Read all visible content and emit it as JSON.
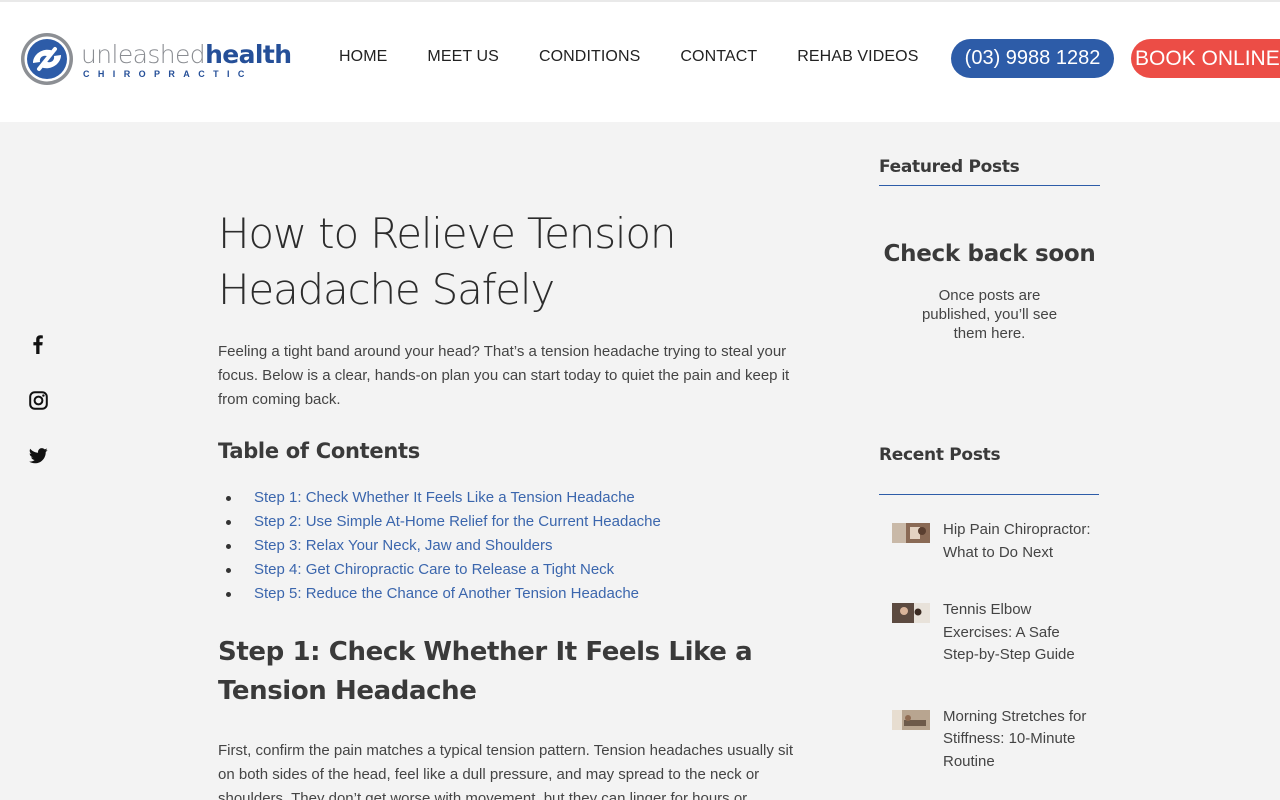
{
  "header": {
    "logo": {
      "word_light": "unleashed",
      "word_bold": "health",
      "tagline": "CHIROPRACTIC"
    },
    "nav": [
      {
        "label": "HOME"
      },
      {
        "label": "MEET US"
      },
      {
        "label": "CONDITIONS"
      },
      {
        "label": "CONTACT"
      },
      {
        "label": "REHAB VIDEOS"
      }
    ],
    "phone_label": "(03) 9988 1282",
    "book_label": "BOOK ONLINE"
  },
  "social": [
    {
      "icon": "facebook-icon"
    },
    {
      "icon": "instagram-icon"
    },
    {
      "icon": "twitter-icon"
    }
  ],
  "article": {
    "title_line1": "How to Relieve Tension",
    "title_line2": "Headache Safely",
    "intro": "Feeling a tight band around your head? That’s a tension headache trying to steal your focus. Below is a clear, hands-on plan you can start today to quiet the pain and keep it from coming back.",
    "toc_title": "Table of Contents",
    "toc": [
      {
        "label": "Step 1: Check Whether It Feels Like a Tension Headache"
      },
      {
        "label": "Step 2: Use Simple At-Home Relief for the Current Headache"
      },
      {
        "label": "Step 3: Relax Your Neck, Jaw and Shoulders"
      },
      {
        "label": "Step 4: Get Chiropractic Care to Release a Tight Neck"
      },
      {
        "label": "Step 5: Reduce the Chance of Another Tension Headache"
      }
    ],
    "step1_title": "Step 1: Check Whether It Feels Like a Tension Headache",
    "step1_body": "First, confirm the pain matches a typical tension pattern. Tension headaches usually sit on both sides of the head, feel like a dull pressure, and may spread to the neck or shoulders. They don’t get worse with movement, but they can linger for hours or"
  },
  "sidebar": {
    "featured_heading": "Featured Posts",
    "check_back_title": "Check back soon",
    "check_back_text": "Once posts are published, you’ll see them here.",
    "recent_heading": "Recent Posts",
    "recent_posts": [
      {
        "title": "Hip Pain Chiropractor: What to Do Next"
      },
      {
        "title": "Tennis Elbow Exercises: A Safe Step-by-Step Guide"
      },
      {
        "title": "Morning Stretches for Stiffness: 10-Minute Routine"
      }
    ]
  },
  "colors": {
    "brand_blue": "#2d5ca8",
    "book_red": "#ec4d46",
    "link_blue": "#3b66ad",
    "page_bg": "#f3f3f3"
  }
}
